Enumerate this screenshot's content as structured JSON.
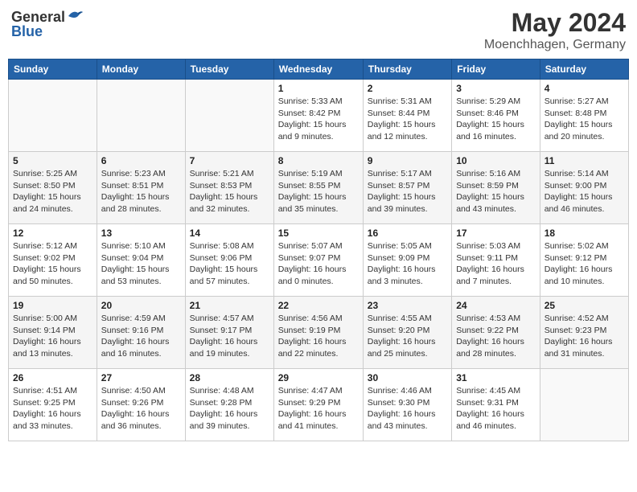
{
  "header": {
    "logo_general": "General",
    "logo_blue": "Blue",
    "month": "May 2024",
    "location": "Moenchhagen, Germany"
  },
  "weekdays": [
    "Sunday",
    "Monday",
    "Tuesday",
    "Wednesday",
    "Thursday",
    "Friday",
    "Saturday"
  ],
  "weeks": [
    [
      {
        "day": "",
        "info": ""
      },
      {
        "day": "",
        "info": ""
      },
      {
        "day": "",
        "info": ""
      },
      {
        "day": "1",
        "info": "Sunrise: 5:33 AM\nSunset: 8:42 PM\nDaylight: 15 hours\nand 9 minutes."
      },
      {
        "day": "2",
        "info": "Sunrise: 5:31 AM\nSunset: 8:44 PM\nDaylight: 15 hours\nand 12 minutes."
      },
      {
        "day": "3",
        "info": "Sunrise: 5:29 AM\nSunset: 8:46 PM\nDaylight: 15 hours\nand 16 minutes."
      },
      {
        "day": "4",
        "info": "Sunrise: 5:27 AM\nSunset: 8:48 PM\nDaylight: 15 hours\nand 20 minutes."
      }
    ],
    [
      {
        "day": "5",
        "info": "Sunrise: 5:25 AM\nSunset: 8:50 PM\nDaylight: 15 hours\nand 24 minutes."
      },
      {
        "day": "6",
        "info": "Sunrise: 5:23 AM\nSunset: 8:51 PM\nDaylight: 15 hours\nand 28 minutes."
      },
      {
        "day": "7",
        "info": "Sunrise: 5:21 AM\nSunset: 8:53 PM\nDaylight: 15 hours\nand 32 minutes."
      },
      {
        "day": "8",
        "info": "Sunrise: 5:19 AM\nSunset: 8:55 PM\nDaylight: 15 hours\nand 35 minutes."
      },
      {
        "day": "9",
        "info": "Sunrise: 5:17 AM\nSunset: 8:57 PM\nDaylight: 15 hours\nand 39 minutes."
      },
      {
        "day": "10",
        "info": "Sunrise: 5:16 AM\nSunset: 8:59 PM\nDaylight: 15 hours\nand 43 minutes."
      },
      {
        "day": "11",
        "info": "Sunrise: 5:14 AM\nSunset: 9:00 PM\nDaylight: 15 hours\nand 46 minutes."
      }
    ],
    [
      {
        "day": "12",
        "info": "Sunrise: 5:12 AM\nSunset: 9:02 PM\nDaylight: 15 hours\nand 50 minutes."
      },
      {
        "day": "13",
        "info": "Sunrise: 5:10 AM\nSunset: 9:04 PM\nDaylight: 15 hours\nand 53 minutes."
      },
      {
        "day": "14",
        "info": "Sunrise: 5:08 AM\nSunset: 9:06 PM\nDaylight: 15 hours\nand 57 minutes."
      },
      {
        "day": "15",
        "info": "Sunrise: 5:07 AM\nSunset: 9:07 PM\nDaylight: 16 hours\nand 0 minutes."
      },
      {
        "day": "16",
        "info": "Sunrise: 5:05 AM\nSunset: 9:09 PM\nDaylight: 16 hours\nand 3 minutes."
      },
      {
        "day": "17",
        "info": "Sunrise: 5:03 AM\nSunset: 9:11 PM\nDaylight: 16 hours\nand 7 minutes."
      },
      {
        "day": "18",
        "info": "Sunrise: 5:02 AM\nSunset: 9:12 PM\nDaylight: 16 hours\nand 10 minutes."
      }
    ],
    [
      {
        "day": "19",
        "info": "Sunrise: 5:00 AM\nSunset: 9:14 PM\nDaylight: 16 hours\nand 13 minutes."
      },
      {
        "day": "20",
        "info": "Sunrise: 4:59 AM\nSunset: 9:16 PM\nDaylight: 16 hours\nand 16 minutes."
      },
      {
        "day": "21",
        "info": "Sunrise: 4:57 AM\nSunset: 9:17 PM\nDaylight: 16 hours\nand 19 minutes."
      },
      {
        "day": "22",
        "info": "Sunrise: 4:56 AM\nSunset: 9:19 PM\nDaylight: 16 hours\nand 22 minutes."
      },
      {
        "day": "23",
        "info": "Sunrise: 4:55 AM\nSunset: 9:20 PM\nDaylight: 16 hours\nand 25 minutes."
      },
      {
        "day": "24",
        "info": "Sunrise: 4:53 AM\nSunset: 9:22 PM\nDaylight: 16 hours\nand 28 minutes."
      },
      {
        "day": "25",
        "info": "Sunrise: 4:52 AM\nSunset: 9:23 PM\nDaylight: 16 hours\nand 31 minutes."
      }
    ],
    [
      {
        "day": "26",
        "info": "Sunrise: 4:51 AM\nSunset: 9:25 PM\nDaylight: 16 hours\nand 33 minutes."
      },
      {
        "day": "27",
        "info": "Sunrise: 4:50 AM\nSunset: 9:26 PM\nDaylight: 16 hours\nand 36 minutes."
      },
      {
        "day": "28",
        "info": "Sunrise: 4:48 AM\nSunset: 9:28 PM\nDaylight: 16 hours\nand 39 minutes."
      },
      {
        "day": "29",
        "info": "Sunrise: 4:47 AM\nSunset: 9:29 PM\nDaylight: 16 hours\nand 41 minutes."
      },
      {
        "day": "30",
        "info": "Sunrise: 4:46 AM\nSunset: 9:30 PM\nDaylight: 16 hours\nand 43 minutes."
      },
      {
        "day": "31",
        "info": "Sunrise: 4:45 AM\nSunset: 9:31 PM\nDaylight: 16 hours\nand 46 minutes."
      },
      {
        "day": "",
        "info": ""
      }
    ]
  ]
}
